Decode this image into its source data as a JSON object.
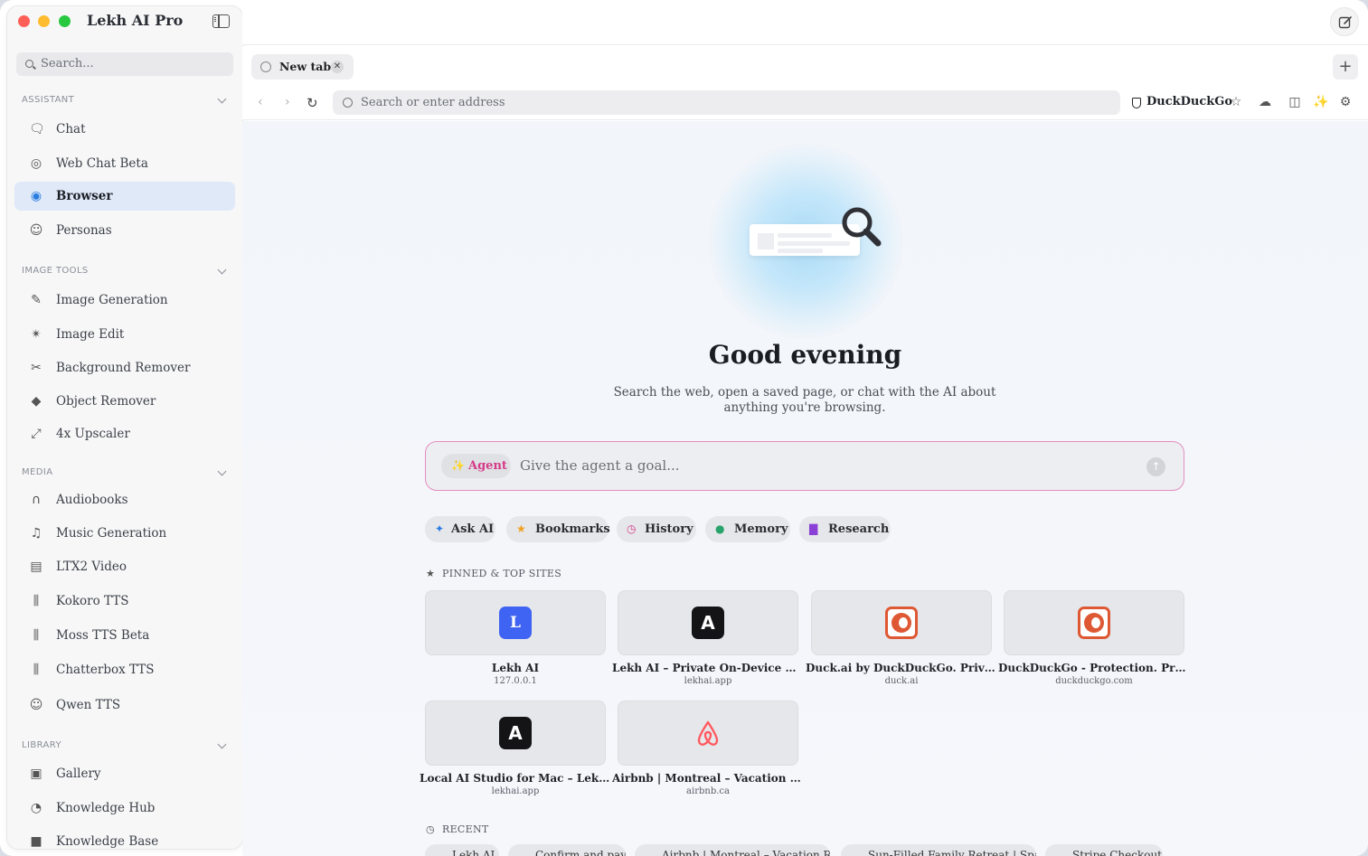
{
  "app": {
    "title": "Lekh AI Pro"
  },
  "sidebar": {
    "search_placeholder": "Search...",
    "sections": [
      {
        "title": "ASSISTANT",
        "items": [
          {
            "label": "Chat",
            "icon": "chat-bubbles-icon"
          },
          {
            "label": "Web Chat Beta",
            "icon": "compass-icon"
          },
          {
            "label": "Browser",
            "icon": "compass-filled-icon",
            "active": true
          },
          {
            "label": "Personas",
            "icon": "masks-icon"
          }
        ]
      },
      {
        "title": "IMAGE TOOLS",
        "items": [
          {
            "label": "Image Generation",
            "icon": "brush-icon"
          },
          {
            "label": "Image Edit",
            "icon": "sparkle-icon"
          },
          {
            "label": "Background Remover",
            "icon": "scissors-icon"
          },
          {
            "label": "Object Remover",
            "icon": "eraser-icon"
          },
          {
            "label": "4x Upscaler",
            "icon": "expand-arrows-icon"
          }
        ]
      },
      {
        "title": "MEDIA",
        "items": [
          {
            "label": "Audiobooks",
            "icon": "headphones-icon"
          },
          {
            "label": "Music Generation",
            "icon": "music-list-icon"
          },
          {
            "label": "LTX2 Video",
            "icon": "film-icon"
          },
          {
            "label": "Kokoro TTS",
            "icon": "waveform-icon"
          },
          {
            "label": "Moss TTS Beta",
            "icon": "waveform-icon"
          },
          {
            "label": "Chatterbox TTS",
            "icon": "waveform-icon"
          },
          {
            "label": "Qwen TTS",
            "icon": "masks-icon"
          }
        ]
      },
      {
        "title": "LIBRARY",
        "items": [
          {
            "label": "Gallery",
            "icon": "photos-icon"
          },
          {
            "label": "Knowledge Hub",
            "icon": "head-icon"
          },
          {
            "label": "Knowledge Base",
            "icon": "folder-icon"
          }
        ]
      }
    ]
  },
  "browser": {
    "tab_label": "New tab",
    "address_placeholder": "Search or enter address",
    "search_engine": "DuckDuckGo",
    "greeting": "Good evening",
    "subtitle": "Search the web, open a saved page, or chat with the AI about anything you're browsing.",
    "agent_label": "Agent",
    "agent_placeholder": "Give the agent a goal...",
    "quick_actions": [
      {
        "label": "Ask AI",
        "icon": "sparkle-icon",
        "color": "#2a7de1"
      },
      {
        "label": "Bookmarks",
        "icon": "star-icon",
        "color": "#f0a020"
      },
      {
        "label": "History",
        "icon": "clock-icon",
        "color": "#d63a88"
      },
      {
        "label": "Memory",
        "icon": "brain-icon",
        "color": "#27a36b"
      },
      {
        "label": "Research",
        "icon": "chart-icon",
        "color": "#8a3fd6"
      }
    ],
    "pinned_title": "PINNED & TOP SITES",
    "pinned_sites": [
      {
        "name": "Lekh AI",
        "url": "127.0.0.1",
        "logo": "L"
      },
      {
        "name": "Lekh AI – Private On-Device AI fo...",
        "url": "lekhai.app",
        "logo": "A"
      },
      {
        "name": "Duck.ai by DuckDuckGo. Private...",
        "url": "duck.ai",
        "logo": "duck"
      },
      {
        "name": "DuckDuckGo - Protection. Privacy...",
        "url": "duckduckgo.com",
        "logo": "duck"
      },
      {
        "name": "Local AI Studio for Mac – Lekh AI...",
        "url": "lekhai.app",
        "logo": "A"
      },
      {
        "name": "Airbnb | Montreal – Vacation Rent...",
        "url": "airbnb.ca",
        "logo": "airbnb"
      }
    ],
    "recent_title": "RECENT",
    "recent": [
      "Lekh AI",
      "Confirm and pay",
      "Airbnb | Montreal – Vacation R...",
      "Sun-Filled Family Retreat | Spa...",
      "Stripe Checkout"
    ],
    "colors": {
      "accent": "#3f63f2",
      "agent_border": "#e58dc0",
      "agent_text": "#d63a88"
    }
  }
}
